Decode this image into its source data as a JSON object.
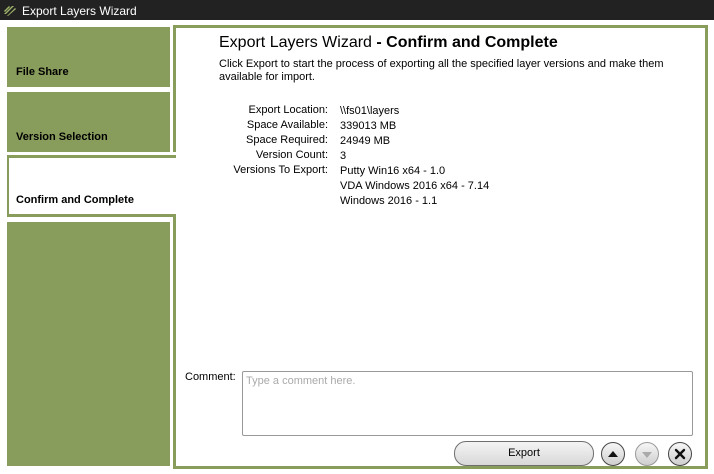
{
  "window": {
    "title": "Export Layers Wizard"
  },
  "steps": [
    {
      "label": "File Share"
    },
    {
      "label": "Version Selection"
    },
    {
      "label": "Confirm and Complete"
    }
  ],
  "heading": {
    "prefix": "Export Layers Wizard",
    "suffix": "- Confirm and Complete"
  },
  "description": "Click Export to start the process of exporting all the specified layer versions and make them available for import.",
  "summary": {
    "export_location_label": "Export Location:",
    "export_location": "\\\\fs01\\layers",
    "space_available_label": "Space Available:",
    "space_available": "339013 MB",
    "space_required_label": "Space Required:",
    "space_required": "24949 MB",
    "version_count_label": "Version Count:",
    "version_count": "3",
    "versions_label": "Versions To Export:",
    "versions": [
      "Putty Win16 x64 - 1.0",
      "VDA Windows 2016 x64 - 7.14",
      "Windows 2016 - 1.1"
    ]
  },
  "comment": {
    "label": "Comment:",
    "value": "",
    "placeholder": "Type a comment here."
  },
  "buttons": {
    "export": "Export"
  },
  "colors": {
    "step_green": "#889c5c",
    "titlebar": "#222222"
  },
  "icons": {
    "app": "app-logo-icon",
    "up": "arrow-up-icon",
    "down": "arrow-down-icon",
    "close": "close-icon"
  }
}
